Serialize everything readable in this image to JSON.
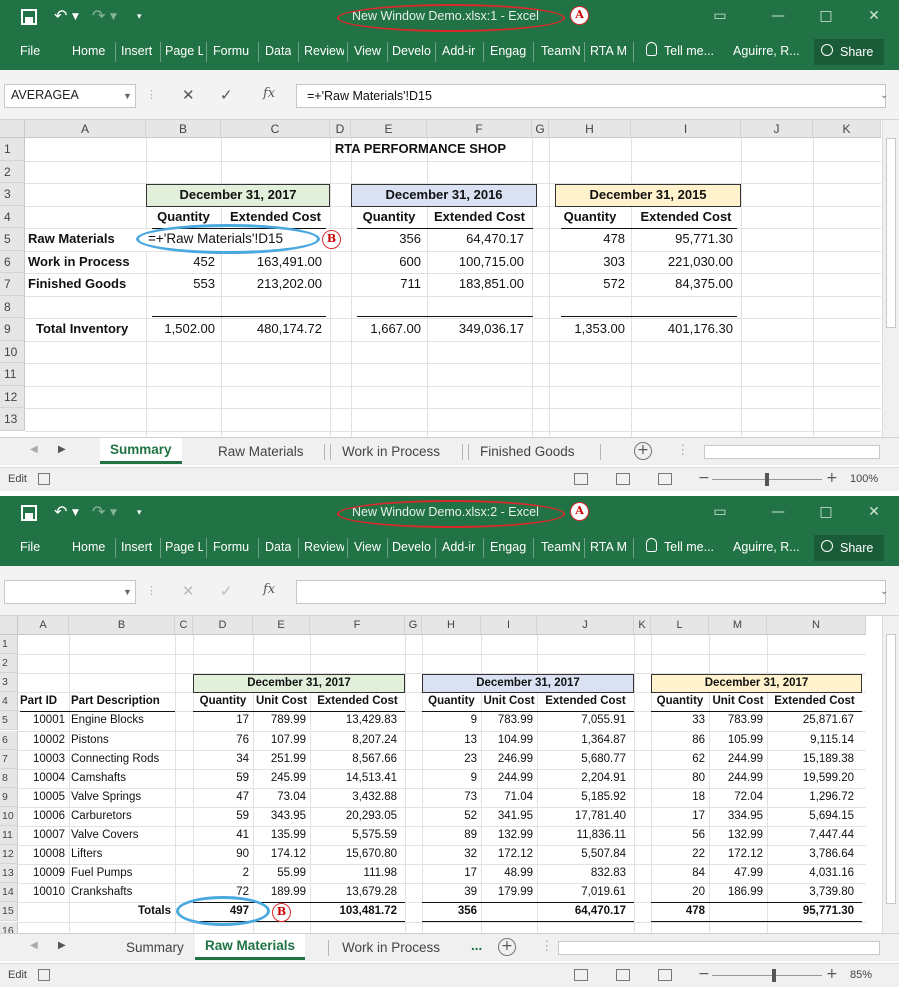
{
  "colors": {
    "excel_green": "#217346",
    "annotation_red": "#d92b2b",
    "annotation_blue": "#49a8df"
  },
  "ribbon_tabs": [
    "File",
    "Home",
    "Insert",
    "Page L",
    "Formu",
    "Data",
    "Review",
    "View",
    "Develo",
    "Add-ir",
    "Engag",
    "TeamN",
    "RTA M"
  ],
  "tell_me": "Tell me...",
  "user": "Aguirre, R...",
  "share": "Share",
  "callouts": {
    "a": "A",
    "b": "B"
  },
  "sheet_tabs": [
    "Summary",
    "Raw Materials",
    "Work in Process",
    "Finished Goods"
  ],
  "sheet_tabs_ellipsis": "...",
  "status_mode": "Edit",
  "window1": {
    "title": "New Window Demo.xlsx:1 - Excel",
    "name_box": "AVERAGEA",
    "formula": "=+'Raw Materials'!D15",
    "zoom": "100%",
    "active_tab": "Summary",
    "columns": [
      "A",
      "B",
      "C",
      "D",
      "E",
      "F",
      "G",
      "H",
      "I",
      "J",
      "K"
    ],
    "rows": [
      "1",
      "2",
      "3",
      "4",
      "5",
      "6",
      "7",
      "8",
      "9",
      "10",
      "11",
      "12",
      "13"
    ],
    "title_cell": "RTA PERFORMANCE SHOP",
    "periods": [
      "December 31, 2017",
      "December 31, 2016",
      "December 31, 2015"
    ],
    "col_quantity": "Quantity",
    "col_extended": "Extended Cost",
    "row_labels": [
      "Raw Materials",
      "Work in Process",
      "Finished Goods",
      "Total Inventory"
    ],
    "editing_cell": "=+'Raw Materials'!D15",
    "values": {
      "p2017": {
        "qty": [
          "",
          "452",
          "553",
          "1,502.00"
        ],
        "cost": [
          "",
          "163,491.00",
          "213,202.00",
          "480,174.72"
        ]
      },
      "p2016": {
        "qty": [
          "356",
          "600",
          "711",
          "1,667.00"
        ],
        "cost": [
          "64,470.17",
          "100,715.00",
          "183,851.00",
          "349,036.17"
        ]
      },
      "p2015": {
        "qty": [
          "478",
          "303",
          "572",
          "1,353.00"
        ],
        "cost": [
          "95,771.30",
          "221,030.00",
          "84,375.00",
          "401,176.30"
        ]
      }
    }
  },
  "window2": {
    "title": "New Window Demo.xlsx:2 - Excel",
    "name_box": "",
    "formula": "",
    "zoom": "85%",
    "zoom_fraction": 0.56,
    "active_tab": "Raw Materials",
    "columns": [
      "A",
      "B",
      "C",
      "D",
      "E",
      "F",
      "G",
      "H",
      "I",
      "J",
      "K",
      "L",
      "M",
      "N"
    ],
    "rows": [
      "1",
      "2",
      "3",
      "4",
      "5",
      "6",
      "7",
      "8",
      "9",
      "10",
      "11",
      "12",
      "13",
      "14",
      "15",
      "16"
    ],
    "periods": [
      "December 31, 2017",
      "December 31, 2017",
      "December 31, 2017"
    ],
    "headers": {
      "part_id": "Part ID",
      "part_desc": "Part Description",
      "quantity": "Quantity",
      "unit_cost": "Unit Cost",
      "extended": "Extended Cost"
    },
    "parts": [
      {
        "id": "10001",
        "desc": "Engine Blocks",
        "g1": [
          "17",
          "789.99",
          "13,429.83"
        ],
        "g2": [
          "9",
          "783.99",
          "7,055.91"
        ],
        "g3": [
          "33",
          "783.99",
          "25,871.67"
        ]
      },
      {
        "id": "10002",
        "desc": "Pistons",
        "g1": [
          "76",
          "107.99",
          "8,207.24"
        ],
        "g2": [
          "13",
          "104.99",
          "1,364.87"
        ],
        "g3": [
          "86",
          "105.99",
          "9,115.14"
        ]
      },
      {
        "id": "10003",
        "desc": "Connecting Rods",
        "g1": [
          "34",
          "251.99",
          "8,567.66"
        ],
        "g2": [
          "23",
          "246.99",
          "5,680.77"
        ],
        "g3": [
          "62",
          "244.99",
          "15,189.38"
        ]
      },
      {
        "id": "10004",
        "desc": "Camshafts",
        "g1": [
          "59",
          "245.99",
          "14,513.41"
        ],
        "g2": [
          "9",
          "244.99",
          "2,204.91"
        ],
        "g3": [
          "80",
          "244.99",
          "19,599.20"
        ]
      },
      {
        "id": "10005",
        "desc": "Valve Springs",
        "g1": [
          "47",
          "73.04",
          "3,432.88"
        ],
        "g2": [
          "73",
          "71.04",
          "5,185.92"
        ],
        "g3": [
          "18",
          "72.04",
          "1,296.72"
        ]
      },
      {
        "id": "10006",
        "desc": "Carburetors",
        "g1": [
          "59",
          "343.95",
          "20,293.05"
        ],
        "g2": [
          "52",
          "341.95",
          "17,781.40"
        ],
        "g3": [
          "17",
          "334.95",
          "5,694.15"
        ]
      },
      {
        "id": "10007",
        "desc": "Valve Covers",
        "g1": [
          "41",
          "135.99",
          "5,575.59"
        ],
        "g2": [
          "89",
          "132.99",
          "11,836.11"
        ],
        "g3": [
          "56",
          "132.99",
          "7,447.44"
        ]
      },
      {
        "id": "10008",
        "desc": "Lifters",
        "g1": [
          "90",
          "174.12",
          "15,670.80"
        ],
        "g2": [
          "32",
          "172.12",
          "5,507.84"
        ],
        "g3": [
          "22",
          "172.12",
          "3,786.64"
        ]
      },
      {
        "id": "10009",
        "desc": "Fuel Pumps",
        "g1": [
          "2",
          "55.99",
          "111.98"
        ],
        "g2": [
          "17",
          "48.99",
          "832.83"
        ],
        "g3": [
          "84",
          "47.99",
          "4,031.16"
        ]
      },
      {
        "id": "10010",
        "desc": "Crankshafts",
        "g1": [
          "72",
          "189.99",
          "13,679.28"
        ],
        "g2": [
          "39",
          "179.99",
          "7,019.61"
        ],
        "g3": [
          "20",
          "186.99",
          "3,739.80"
        ]
      }
    ],
    "totals_label": "Totals",
    "totals": {
      "g1": [
        "497",
        "103,481.72"
      ],
      "g2": [
        "356",
        "64,470.17"
      ],
      "g3": [
        "478",
        "95,771.30"
      ]
    }
  }
}
